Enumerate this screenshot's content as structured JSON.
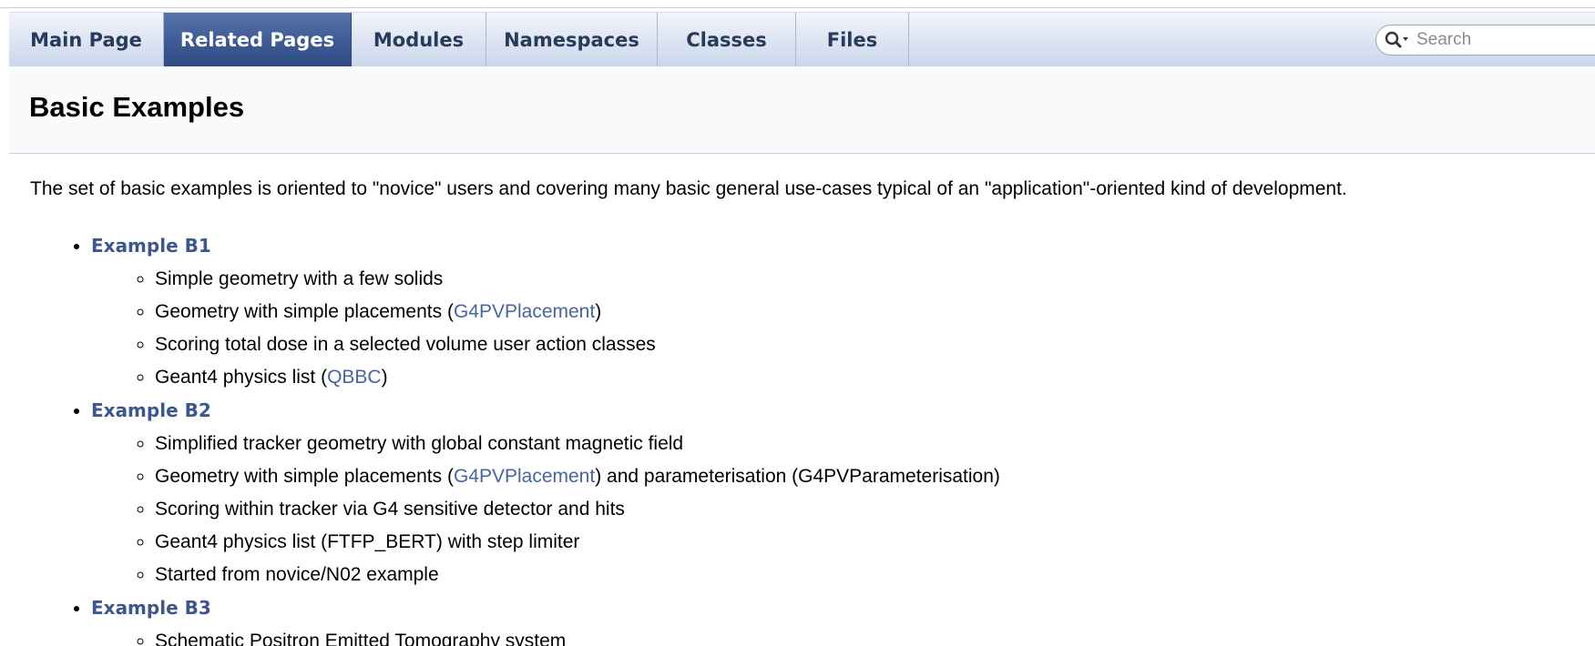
{
  "nav": {
    "tabs": [
      {
        "label": "Main Page",
        "active": false
      },
      {
        "label": "Related Pages",
        "active": true
      },
      {
        "label": "Modules",
        "active": false
      },
      {
        "label": "Namespaces",
        "active": false
      },
      {
        "label": "Classes",
        "active": false
      },
      {
        "label": "Files",
        "active": false
      }
    ],
    "search": {
      "placeholder": "Search"
    }
  },
  "page": {
    "title": "Basic Examples",
    "intro": "The set of basic examples is oriented to \"novice\" users and covering many basic general use-cases typical of an \"application\"-oriented kind of development."
  },
  "examples": [
    {
      "name": "Example B1",
      "items": [
        {
          "text": "Simple geometry with a few solids"
        },
        {
          "before": "Geometry with simple placements (",
          "link": "G4PVPlacement",
          "after": ")"
        },
        {
          "text": "Scoring total dose in a selected volume user action classes"
        },
        {
          "before": "Geant4 physics list (",
          "link": "QBBC",
          "after": ")"
        }
      ]
    },
    {
      "name": "Example B2",
      "items": [
        {
          "text": "Simplified tracker geometry with global constant magnetic field"
        },
        {
          "before": "Geometry with simple placements (",
          "link": "G4PVPlacement",
          "after": ") and parameterisation (G4PVParameterisation)"
        },
        {
          "text": "Scoring within tracker via G4 sensitive detector and hits"
        },
        {
          "text": "Geant4 physics list (FTFP_BERT) with step limiter"
        },
        {
          "text": "Started from novice/N02 example"
        }
      ]
    },
    {
      "name": "Example B3",
      "items": [
        {
          "text": "Schematic Positron Emitted Tomography system"
        }
      ]
    }
  ],
  "colors": {
    "link": "#4665a2",
    "example_link": "#3d578c",
    "active_tab": "#3d5a95",
    "tab_text": "#283a5d"
  }
}
